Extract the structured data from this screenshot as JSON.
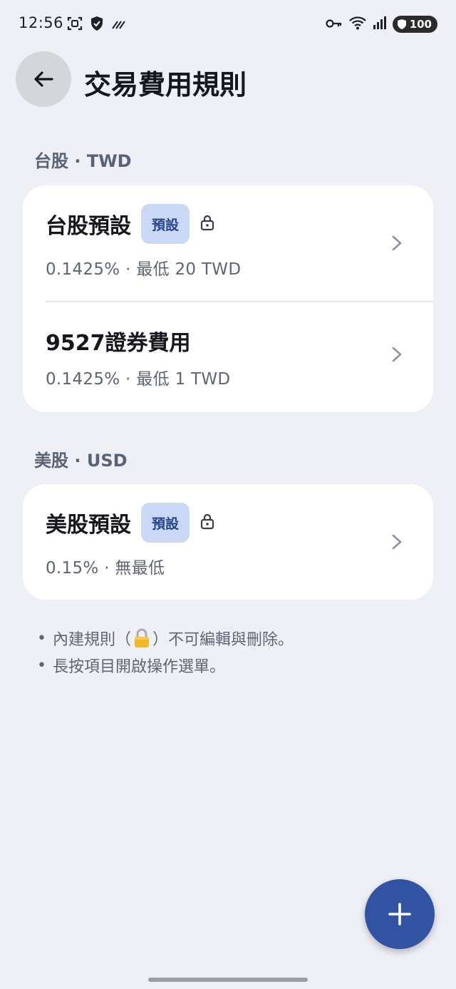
{
  "status_bar": {
    "time": "12:56",
    "battery": "100"
  },
  "header": {
    "title": "交易費用規則"
  },
  "sections": [
    {
      "label": "台股 · TWD",
      "rules": [
        {
          "name": "台股預設",
          "badge": "預設",
          "locked": true,
          "detail": "0.1425% · 最低 20 TWD"
        },
        {
          "name": "9527證券費用",
          "locked": false,
          "detail": "0.1425% · 最低 1 TWD"
        }
      ]
    },
    {
      "label": "美股 · USD",
      "rules": [
        {
          "name": "美股預設",
          "badge": "預設",
          "locked": true,
          "detail": "0.15% · 無最低"
        }
      ]
    }
  ],
  "notes": {
    "bullet": "•",
    "line1_before": "內建規則（",
    "line1_after": "）不可編輯與刪除。",
    "line2": "長按項目開啟操作選單。"
  },
  "colors": {
    "background": "#eef0f5",
    "card": "#ffffff",
    "badge_bg": "#c9d9f5",
    "badge_text": "#28448a",
    "fab": "#3253a3"
  }
}
